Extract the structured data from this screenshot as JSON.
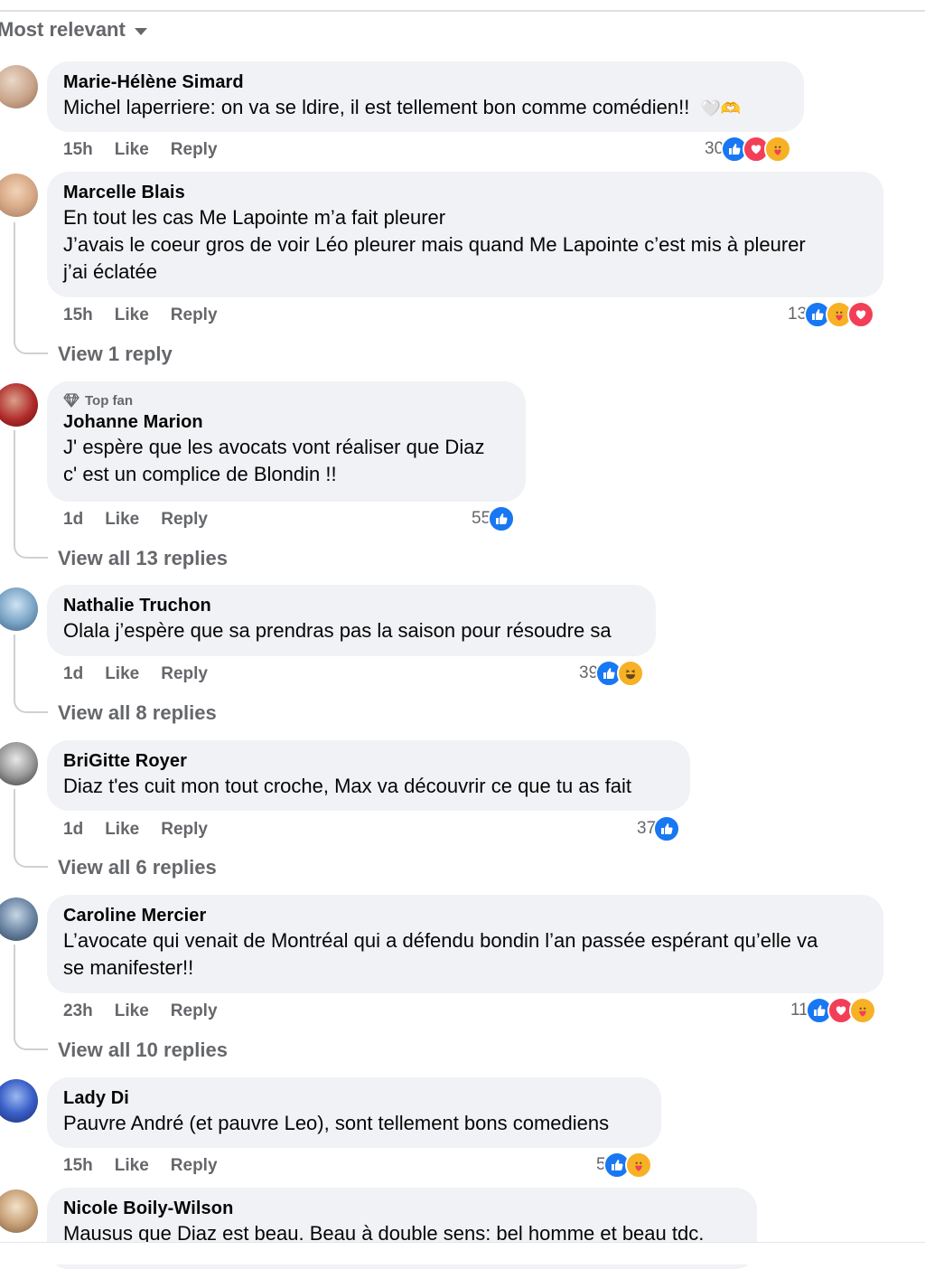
{
  "sort": {
    "label": "Most relevant"
  },
  "comments": [
    {
      "name": "Marie-Hélène Simard",
      "lines": [
        "Michel laperriere: on va se ldire, il est tellement bon comme comédien!!"
      ],
      "emoji": "🤍🫶",
      "time": "15h",
      "like": "Like",
      "reply": "Reply",
      "reactions": {
        "count": "30",
        "icons": [
          "like-icon",
          "love-icon",
          "care-icon"
        ]
      },
      "view_replies": ""
    },
    {
      "name": "Marcelle Blais",
      "lines": [
        "En tout les cas Me Lapointe m’a fait pleurer",
        "J’avais le coeur gros de voir Léo pleurer mais quand Me Lapointe c’est mis à pleurer",
        "j’ai éclatée"
      ],
      "time": "15h",
      "like": "Like",
      "reply": "Reply",
      "reactions": {
        "count": "13",
        "icons": [
          "like-icon",
          "care-icon",
          "love-icon"
        ]
      },
      "view_replies": "View 1 reply"
    },
    {
      "badge": "Top fan",
      "name": "Johanne Marion",
      "lines": [
        "J' espère que les avocats vont réaliser que Diaz",
        "c' est un complice de Blondin !!"
      ],
      "time": "1d",
      "like": "Like",
      "reply": "Reply",
      "reactions": {
        "count": "55",
        "icons": [
          "like-icon"
        ]
      },
      "view_replies": "View all 13 replies"
    },
    {
      "name": "Nathalie Truchon",
      "lines": [
        "Olala j’espère que sa prendras pas la saison pour résoudre sa"
      ],
      "time": "1d",
      "like": "Like",
      "reply": "Reply",
      "reactions": {
        "count": "39",
        "icons": [
          "like-icon",
          "haha-icon"
        ]
      },
      "view_replies": "View all 8 replies"
    },
    {
      "name": "BriGitte Royer",
      "lines": [
        "Diaz t'es cuit mon tout croche, Max va découvrir ce que tu as fait"
      ],
      "time": "1d",
      "like": "Like",
      "reply": "Reply",
      "reactions": {
        "count": "37",
        "icons": [
          "like-icon"
        ]
      },
      "view_replies": "View all 6 replies"
    },
    {
      "name": "Caroline Mercier",
      "lines": [
        "L’avocate qui venait de Montréal qui a défendu bondin l’an passée espérant qu’elle va",
        "se manifester!!"
      ],
      "time": "23h",
      "like": "Like",
      "reply": "Reply",
      "reactions": {
        "count": "11",
        "icons": [
          "like-icon",
          "love-icon",
          "care-icon"
        ]
      },
      "view_replies": "View all 10 replies"
    },
    {
      "name": "Lady Di",
      "lines": [
        "Pauvre André (et pauvre Leo), sont tellement bons comediens"
      ],
      "time": "15h",
      "like": "Like",
      "reply": "Reply",
      "reactions": {
        "count": "5",
        "icons": [
          "like-icon",
          "care-icon"
        ]
      },
      "view_replies": ""
    },
    {
      "name": "Nicole Boily-Wilson",
      "lines": [
        "Mausus que Diaz est beau. Beau à double sens: bel homme et beau tdc."
      ],
      "view_replies": ""
    }
  ],
  "colors": {
    "accent": "#1877f2",
    "love": "#f33e58",
    "care": "#f7b125",
    "bubble": "#f0f2f5",
    "meta": "#65676b"
  }
}
